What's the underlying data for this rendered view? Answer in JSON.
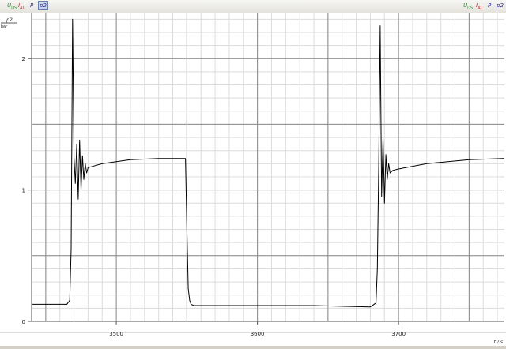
{
  "toolbar": {
    "left": [
      {
        "name": "U-DS",
        "base": "U",
        "sub": "DS",
        "color": "#2a8a2a",
        "active": false
      },
      {
        "name": "I-AL",
        "base": "I",
        "sub": "AL",
        "color": "#c02020",
        "active": false
      },
      {
        "name": "P",
        "base": "P",
        "sub": "",
        "color": "#2a2a9a",
        "active": false
      },
      {
        "name": "p2",
        "base": "p2",
        "sub": "",
        "color": "#2a2a9a",
        "active": true
      }
    ],
    "right": [
      {
        "name": "U-DS",
        "base": "U",
        "sub": "DS",
        "color": "#2a8a2a"
      },
      {
        "name": "I-AL",
        "base": "I",
        "sub": "AL",
        "color": "#c02020"
      },
      {
        "name": "P",
        "base": "P",
        "sub": "",
        "color": "#2a2a9a"
      },
      {
        "name": "p2",
        "base": "p2",
        "sub": "",
        "color": "#2a2a9a"
      }
    ]
  },
  "chart_data": {
    "type": "line",
    "ylabel_top": "p2",
    "ylabel_bottom": "bar",
    "xlabel": "t / s",
    "xlim": [
      3440,
      3775
    ],
    "ylim": [
      0,
      2.35
    ],
    "x_ticks": [
      3500,
      3600,
      3700
    ],
    "x_tick_labels": [
      "3500",
      "3600",
      "3700"
    ],
    "y_ticks": [
      0,
      1,
      2
    ],
    "y_tick_labels": [
      "0",
      "1",
      "2"
    ],
    "grid": true,
    "series": [
      {
        "color": "#000000",
        "x": [
          3440,
          3465,
          3467,
          3468,
          3469,
          3470,
          3471,
          3472,
          3473,
          3474,
          3475,
          3476,
          3477,
          3478,
          3479,
          3480,
          3490,
          3510,
          3530,
          3549,
          3550,
          3551,
          3552,
          3553,
          3555,
          3560,
          3600,
          3640,
          3680,
          3684,
          3685,
          3686,
          3687,
          3688,
          3689,
          3690,
          3691,
          3692,
          3693,
          3694,
          3696,
          3700,
          3720,
          3750,
          3775
        ],
        "y": [
          0.13,
          0.13,
          0.16,
          0.55,
          2.3,
          1.25,
          1.05,
          1.35,
          0.93,
          1.38,
          1.0,
          1.26,
          1.08,
          1.2,
          1.13,
          1.17,
          1.2,
          1.23,
          1.24,
          1.24,
          0.7,
          0.25,
          0.16,
          0.13,
          0.12,
          0.12,
          0.12,
          0.12,
          0.11,
          0.14,
          0.4,
          1.2,
          2.25,
          0.95,
          1.4,
          0.9,
          1.27,
          1.08,
          1.2,
          1.13,
          1.15,
          1.16,
          1.2,
          1.23,
          1.24
        ]
      }
    ]
  }
}
